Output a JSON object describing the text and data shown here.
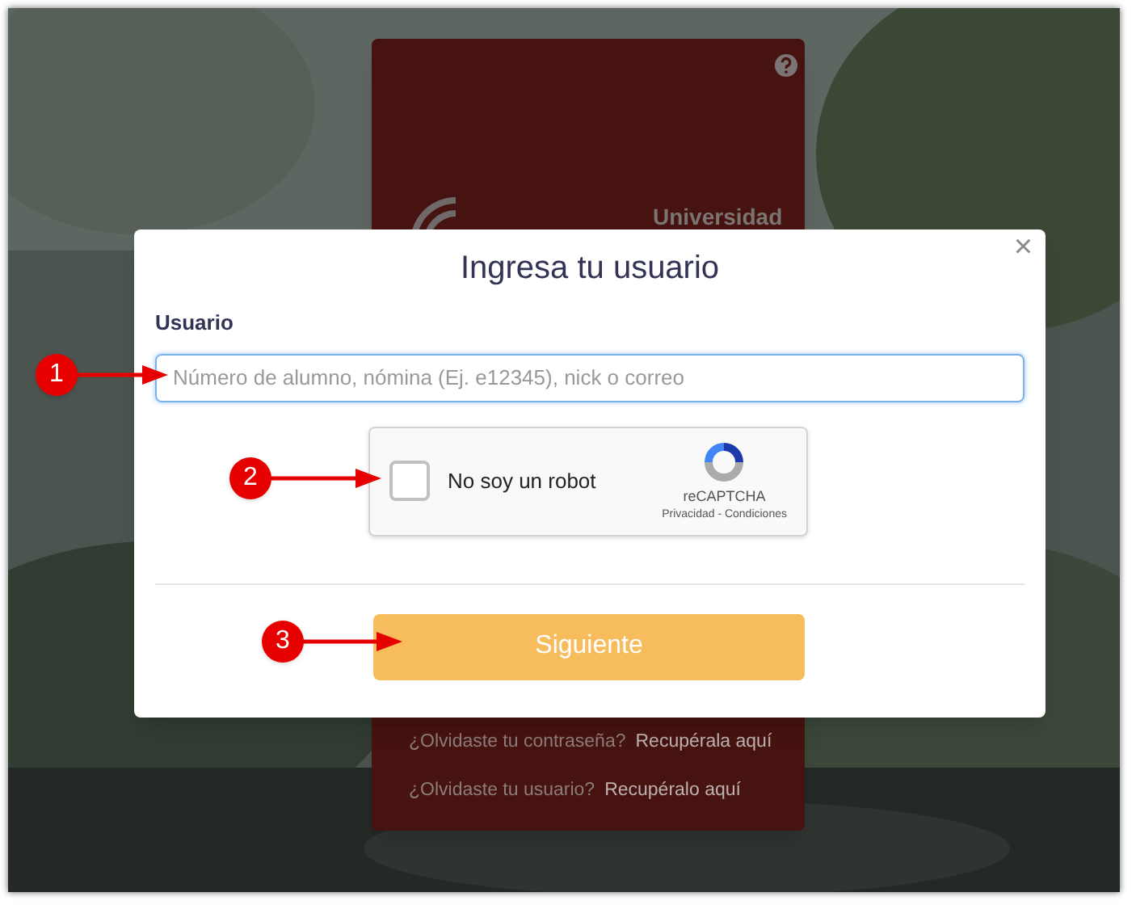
{
  "background_card": {
    "logo_text": "Universidad",
    "links": [
      {
        "question": "¿Olvidaste tu contraseña?",
        "link": "Recupérala aquí"
      },
      {
        "question": "¿Olvidaste tu usuario?",
        "link": "Recupéralo aquí"
      }
    ]
  },
  "modal": {
    "title": "Ingresa tu usuario",
    "close": "×",
    "field_label": "Usuario",
    "field": {
      "placeholder": "Número de alumno, nómina (Ej. e12345), nick o correo"
    },
    "captcha": {
      "label": "No soy un robot",
      "checked": false,
      "brand": "reCAPTCHA",
      "terms": "Privacidad - Condiciones"
    },
    "button": "Siguiente"
  },
  "callouts": [
    {
      "number": "1"
    },
    {
      "number": "2"
    },
    {
      "number": "3"
    }
  ]
}
